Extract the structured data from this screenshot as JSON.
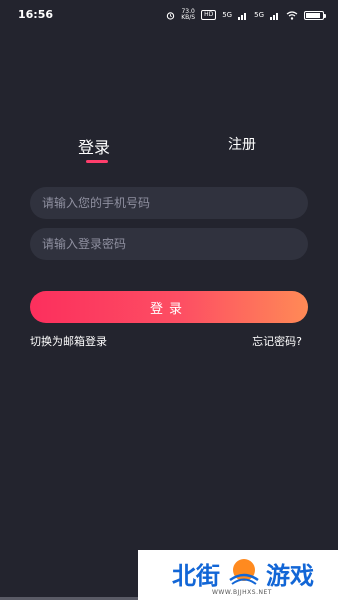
{
  "status_bar": {
    "time": "16:56",
    "speed_value": "73.0",
    "speed_unit": "KB/S",
    "hd_badge": "HD",
    "signal_1": "5G",
    "signal_2": "5G",
    "battery_level": 0.85
  },
  "tabs": [
    {
      "label": "登录",
      "active": true
    },
    {
      "label": "注册",
      "active": false
    }
  ],
  "form": {
    "phone_placeholder": "请输入您的手机号码",
    "password_placeholder": "请输入登录密码",
    "phone_value": "",
    "password_value": ""
  },
  "login_button_label": "登录",
  "links": {
    "switch_email": "切换为邮箱登录",
    "forgot_password": "忘记密码?"
  },
  "watermark": {
    "text_left": "北街",
    "text_right": "游戏",
    "url": "WWW.BJJHXS.NET"
  },
  "colors": {
    "background": "#23242e",
    "field": "#30323e",
    "accent": "#fc2f5d",
    "accent_end": "#ff8a56"
  }
}
